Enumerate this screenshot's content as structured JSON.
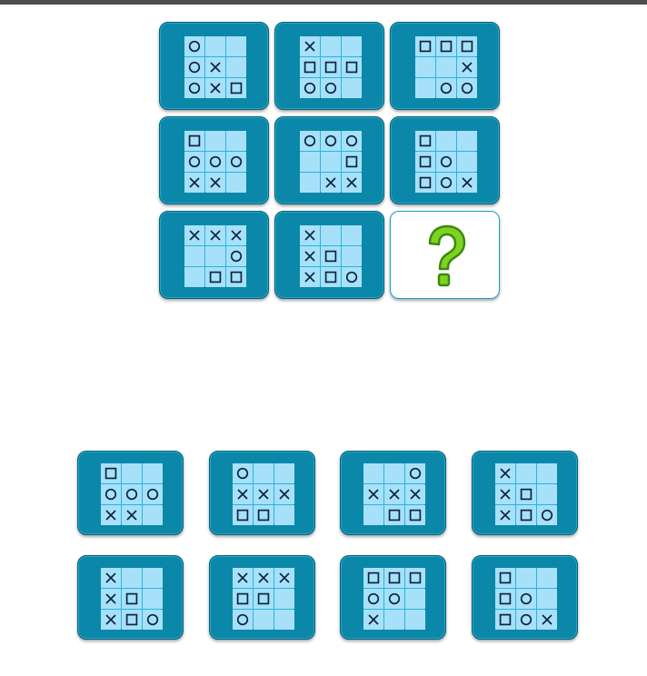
{
  "puzzle": {
    "grid": [
      [
        [
          "circle",
          "",
          ""
        ],
        [
          "circle",
          "cross",
          ""
        ],
        [
          "circle",
          "cross",
          "square"
        ]
      ],
      [
        [
          "cross",
          "",
          ""
        ],
        [
          "square",
          "square",
          "square"
        ],
        [
          "circle",
          "circle",
          ""
        ]
      ],
      [
        [
          "square",
          "square",
          "square"
        ],
        [
          "",
          "",
          "cross"
        ],
        [
          "",
          "circle",
          "circle"
        ]
      ],
      [
        [
          "square",
          "",
          ""
        ],
        [
          "circle",
          "circle",
          "circle"
        ],
        [
          "cross",
          "cross",
          ""
        ]
      ],
      [
        [
          "circle",
          "circle",
          "circle"
        ],
        [
          "",
          "",
          "square"
        ],
        [
          "",
          "cross",
          "cross"
        ]
      ],
      [
        [
          "square",
          "",
          ""
        ],
        [
          "square",
          "circle",
          ""
        ],
        [
          "square",
          "circle",
          "cross"
        ]
      ],
      [
        [
          "cross",
          "cross",
          "cross"
        ],
        [
          "",
          "",
          "circle"
        ],
        [
          "",
          "square",
          "square"
        ]
      ],
      [
        [
          "cross",
          "",
          ""
        ],
        [
          "cross",
          "square",
          ""
        ],
        [
          "cross",
          "square",
          "circle"
        ]
      ]
    ],
    "missing_icon": "question-mark-icon",
    "question_color": "#7ed321"
  },
  "answers": [
    [
      [
        "square",
        "",
        ""
      ],
      [
        "circle",
        "circle",
        "circle"
      ],
      [
        "cross",
        "cross",
        ""
      ]
    ],
    [
      [
        "circle",
        "",
        ""
      ],
      [
        "cross",
        "cross",
        "cross"
      ],
      [
        "square",
        "square",
        ""
      ]
    ],
    [
      [
        "",
        "",
        "circle"
      ],
      [
        "cross",
        "cross",
        "cross"
      ],
      [
        "",
        "square",
        "square"
      ]
    ],
    [
      [
        "cross",
        "",
        ""
      ],
      [
        "cross",
        "square",
        ""
      ],
      [
        "cross",
        "square",
        "circle"
      ]
    ],
    [
      [
        "cross",
        "",
        ""
      ],
      [
        "cross",
        "square",
        ""
      ],
      [
        "cross",
        "square",
        "circle"
      ]
    ],
    [
      [
        "cross",
        "cross",
        "cross"
      ],
      [
        "square",
        "square",
        ""
      ],
      [
        "circle",
        "",
        ""
      ]
    ],
    [
      [
        "square",
        "square",
        "square"
      ],
      [
        "circle",
        "circle",
        ""
      ],
      [
        "cross",
        "",
        ""
      ]
    ],
    [
      [
        "square",
        "",
        ""
      ],
      [
        "square",
        "circle",
        ""
      ],
      [
        "square",
        "circle",
        "cross"
      ]
    ]
  ],
  "colors": {
    "tile": "#0b87a9",
    "cell": "#a6e1f9",
    "gridline": "#2db3dc",
    "symbol": "#0d2440"
  }
}
